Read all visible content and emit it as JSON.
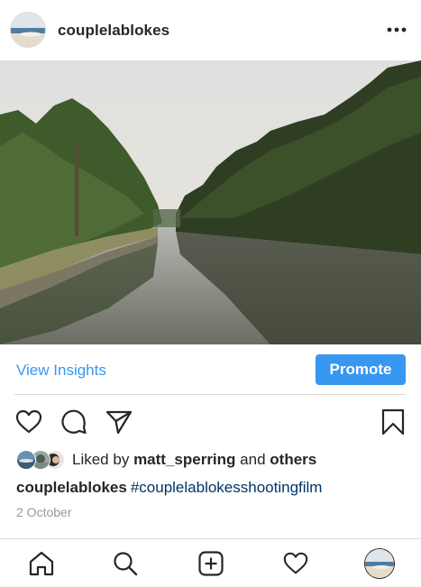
{
  "post": {
    "username": "couplelablokes",
    "avatar_icon": "beach-landscape-thumbnail",
    "more_icon": "more-horizontal-icon",
    "photo_description_icon": "river-landscape-photo"
  },
  "insights": {
    "view_insights_label": "View Insights",
    "promote_label": "Promote",
    "accent_color": "#3897f0"
  },
  "actions": {
    "like_icon": "heart-outline-icon",
    "comment_icon": "comment-icon",
    "share_icon": "paper-plane-icon",
    "save_icon": "bookmark-icon"
  },
  "likes": {
    "prefix": "Liked by",
    "first_liker": "matt_sperring",
    "connector": "and",
    "suffix": "others"
  },
  "caption": {
    "username": "couplelablokes",
    "hashtag": "#couplelablokesshootingfilm"
  },
  "date": "2 October",
  "bottom_nav": {
    "items": [
      {
        "icon": "home-icon"
      },
      {
        "icon": "search-icon"
      },
      {
        "icon": "add-post-icon"
      },
      {
        "icon": "activity-heart-icon"
      },
      {
        "icon": "profile-avatar"
      }
    ]
  }
}
